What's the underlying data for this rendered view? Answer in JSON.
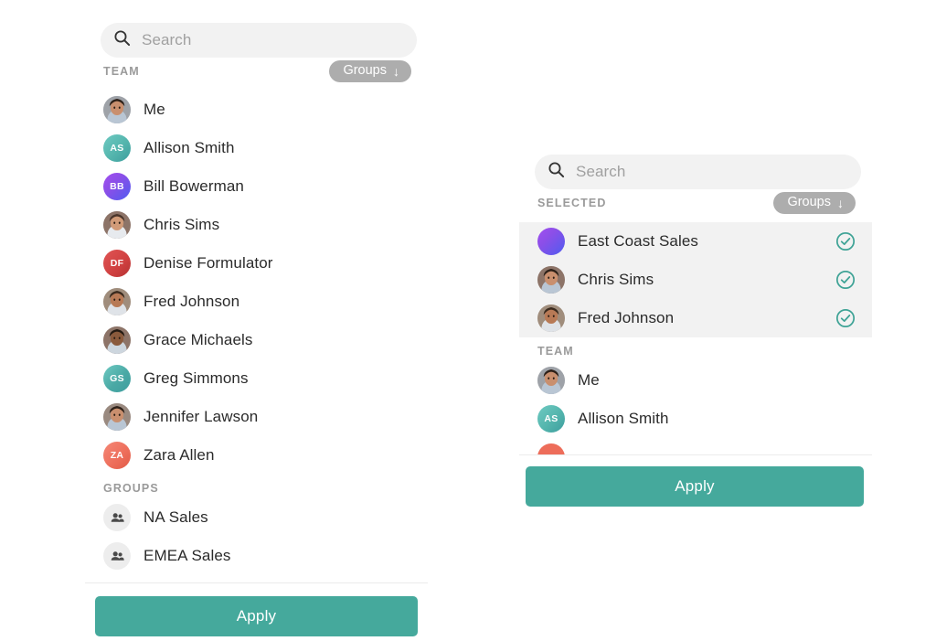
{
  "left_panel": {
    "search": {
      "placeholder": "Search",
      "value": "",
      "icon": "search-icon"
    },
    "header": {
      "title": "TEAM",
      "groups_button": {
        "label": "Groups",
        "icon": "arrow-down-icon",
        "arrow": "↓"
      }
    },
    "team_members": [
      {
        "name": "Me",
        "avatar_type": "photo",
        "initials": "",
        "color": "#9ea2a8"
      },
      {
        "name": "Allison Smith",
        "avatar_type": "initials",
        "initials": "AS",
        "color": "#54b5ad"
      },
      {
        "name": "Bill Bowerman",
        "avatar_type": "initials",
        "initials": "BB",
        "color": "#8b4fe8"
      },
      {
        "name": "Chris Sims",
        "avatar_type": "photo",
        "initials": "",
        "color": "#8d7468"
      },
      {
        "name": "Denise Formulator",
        "avatar_type": "initials",
        "initials": "DF",
        "color": "#cf4040"
      },
      {
        "name": "Fred Johnson",
        "avatar_type": "photo",
        "initials": "",
        "color": "#a08d7c"
      },
      {
        "name": "Grace Michaels",
        "avatar_type": "photo",
        "initials": "",
        "color": "#8d7468"
      },
      {
        "name": "Greg Simmons",
        "avatar_type": "initials",
        "initials": "GS",
        "color": "#4aa9a5"
      },
      {
        "name": "Jennifer Lawson",
        "avatar_type": "photo",
        "initials": "",
        "color": "#9a8a80"
      },
      {
        "name": "Zara Allen",
        "avatar_type": "initials",
        "initials": "ZA",
        "color": "#ed6d5a"
      }
    ],
    "groups_section": {
      "title": "GROUPS",
      "items": [
        {
          "name": "NA Sales",
          "avatar_type": "group",
          "icon": "people-icon"
        },
        {
          "name": "EMEA Sales",
          "avatar_type": "group",
          "icon": "people-icon"
        }
      ]
    },
    "apply_label": "Apply"
  },
  "right_panel": {
    "search": {
      "placeholder": "Search",
      "value": "",
      "icon": "search-icon"
    },
    "header": {
      "title": "SELECTED",
      "groups_button": {
        "label": "Groups",
        "icon": "arrow-down-icon",
        "arrow": "↓"
      }
    },
    "selected_items": [
      {
        "name": "East Coast Sales",
        "avatar_type": "gradient",
        "initials": "",
        "color": "#8b4fe8",
        "checked": true,
        "check_icon": "check-circle-icon"
      },
      {
        "name": "Chris Sims",
        "avatar_type": "photo",
        "initials": "",
        "color": "#8d7468",
        "checked": true,
        "check_icon": "check-circle-icon"
      },
      {
        "name": "Fred Johnson",
        "avatar_type": "photo",
        "initials": "",
        "color": "#a08d7c",
        "checked": true,
        "check_icon": "check-circle-icon"
      }
    ],
    "team_section": {
      "title": "TEAM",
      "items": [
        {
          "name": "Me",
          "avatar_type": "photo",
          "initials": "",
          "color": "#9ea2a8"
        },
        {
          "name": "Allison Smith",
          "avatar_type": "initials",
          "initials": "AS",
          "color": "#54b5ad"
        },
        {
          "name": "",
          "avatar_type": "initials",
          "initials": "",
          "color": "#ed6d5a"
        }
      ]
    },
    "apply_label": "Apply"
  },
  "theme": {
    "accent": "#45a99c",
    "check": "#3fa396",
    "pill_bg": "#adadad",
    "field_bg": "#f2f2f2",
    "selected_bg": "#f2f2f2",
    "text": "#2b2b2b",
    "muted": "#9a9a9a",
    "divider": "#ebebeb",
    "background": "#ffffff"
  }
}
